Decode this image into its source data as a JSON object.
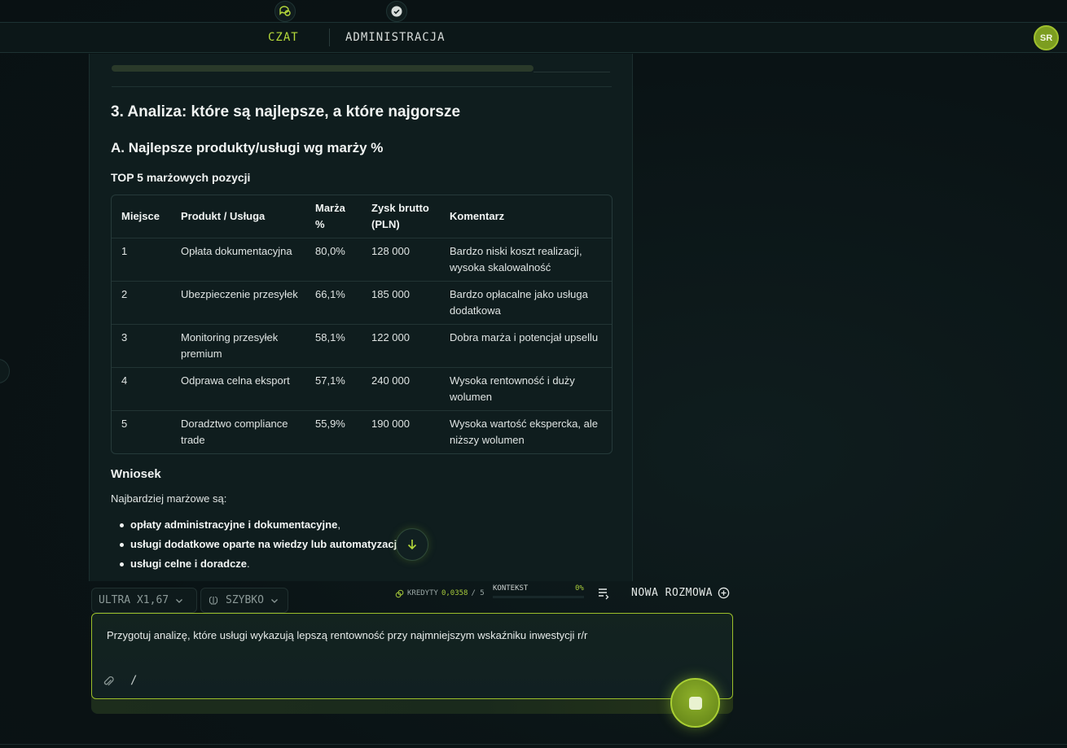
{
  "nav": {
    "tab_chat": "CZAT",
    "tab_admin": "ADMINISTRACJA",
    "avatar": "SR"
  },
  "content": {
    "heading_section": "3. Analiza: które są najlepsze, a które najgorsze",
    "heading_sub": "A. Najlepsze produkty/usługi wg marży %",
    "heading_table": "TOP 5 marżowych pozycji",
    "table": {
      "headers": [
        "Miejsce",
        "Produkt / Usługa",
        "Marża %",
        "Zysk brutto (PLN)",
        "Komentarz"
      ],
      "rows": [
        [
          "1",
          "Opłata dokumentacyjna",
          "80,0%",
          "128 000",
          "Bardzo niski koszt realizacji, wysoka skalowalność"
        ],
        [
          "2",
          "Ubezpieczenie przesyłek",
          "66,1%",
          "185 000",
          "Bardzo opłacalne jako usługa dodatkowa"
        ],
        [
          "3",
          "Monitoring przesyłek premium",
          "58,1%",
          "122 000",
          "Dobra marża i potencjał upsellu"
        ],
        [
          "4",
          "Odprawa celna eksport",
          "57,1%",
          "240 000",
          "Wysoka rentowność i duży wolumen"
        ],
        [
          "5",
          "Doradztwo compliance trade",
          "55,9%",
          "190 000",
          "Wysoka wartość ekspercka, ale niższy wolumen"
        ]
      ]
    },
    "conclusion_title": "Wniosek",
    "conclusion_intro": "Najbardziej marżowe są:",
    "bullets": [
      {
        "bold": "opłaty administracyjne i dokumentacyjne",
        "tail": ","
      },
      {
        "bold": "usługi dodatkowe oparte na wiedzy lub automatyzacji",
        "tail": ""
      },
      {
        "bold": "usługi celne i doradcze",
        "tail": "."
      }
    ]
  },
  "toolbar": {
    "model": "ULTRA X1,67",
    "speed": "SZYBKO",
    "credits_label": "KREDYTY",
    "credits_value": "0,0358",
    "credits_total": "/ 5",
    "context_label": "KONTEKST",
    "context_pct": "0%",
    "new_chat": "NOWA ROZMOWA"
  },
  "composer": {
    "text": "Przygotuj analizę, które usługi wykazują lepszą rentowność przy najmniejszym wskaźniku inwestycji r/r",
    "slash": "/"
  },
  "colors": {
    "accent": "#a8cf2f",
    "background": "#0b1416",
    "panel": "#0f1d1e"
  }
}
